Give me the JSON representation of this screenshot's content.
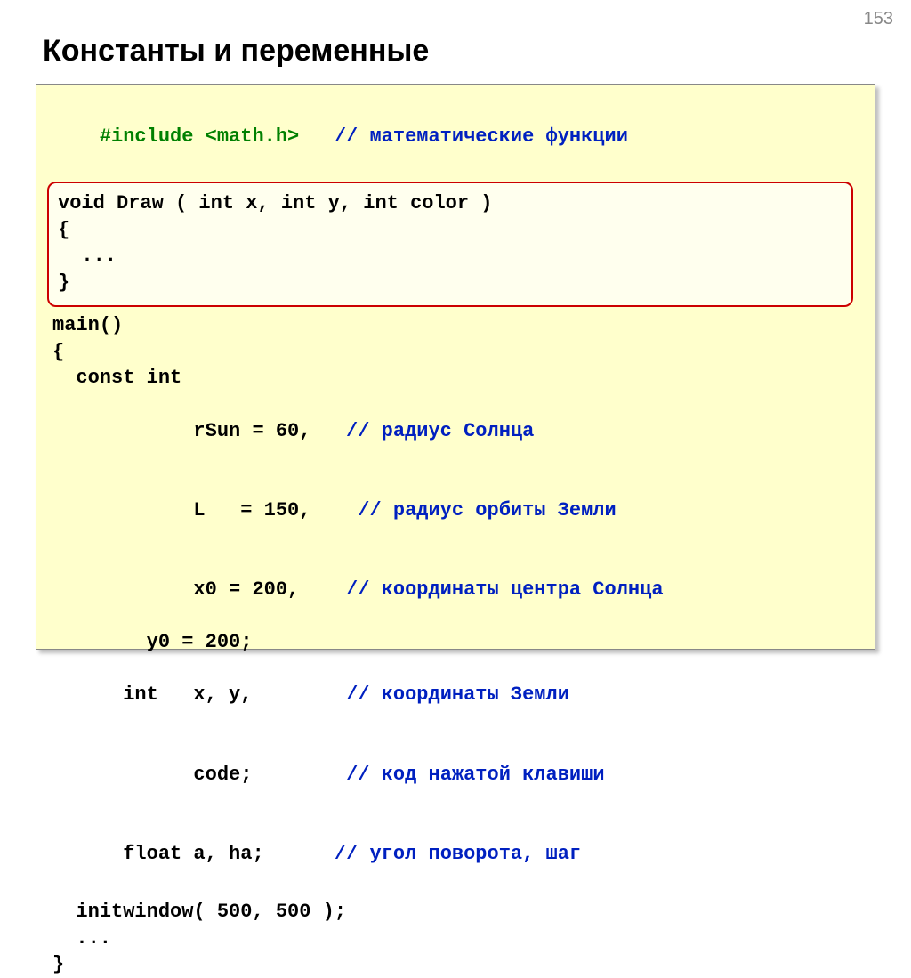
{
  "page_number": "153",
  "title": "Константы и переменные",
  "code": {
    "include_directive": "#include <math.h>",
    "include_comment": "// математические функции",
    "func_sig": "void Draw ( int x, int y, int color )",
    "brace_open": "{",
    "ellipsis": "  ...",
    "brace_close": "}",
    "main_sig": "main()",
    "main_open": "{",
    "const_kw": "  const int",
    "rSun_decl": "        rSun = 60,",
    "rSun_cmt": "   // радиус Солнца",
    "L_decl": "        L   = 150,",
    "L_cmt": "    // радиус орбиты Земли",
    "x0_decl": "        x0 = 200,",
    "x0_cmt": "    // координаты центра Солнца",
    "y0_decl": "        y0 = 200;",
    "int_decl": "  int   x, y,",
    "int_cmt": "        // координаты Земли",
    "code_decl": "        code;",
    "code_cmt": "        // код нажатой клавиши",
    "float_decl": "  float a, ha;",
    "float_cmt": "      // угол поворота, шаг",
    "initwin": "  initwindow( 500, 500 );",
    "main_ellip": "  ...",
    "main_close": "}"
  }
}
